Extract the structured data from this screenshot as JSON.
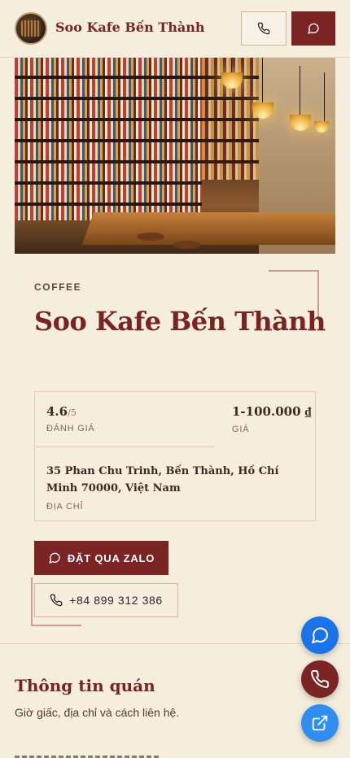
{
  "header": {
    "brand": "Soo Kafe Bến Thành",
    "call_icon": "phone-icon",
    "chat_icon": "chat-bubble-icon",
    "accent_color": "#7b2423"
  },
  "hero": {
    "alt_icon": "cafe-interior-photo"
  },
  "place": {
    "category": "COFFEE",
    "name": "Soo Kafe Bến Thành",
    "rating": "4.6",
    "rating_suffix": "/5",
    "rating_label": "ĐÁNH GIÁ",
    "price": "1-100.000 ₫",
    "price_label": "GIÁ",
    "address": "35 Phan Chu Trinh, Bến Thành, Hồ Chí Minh 70000, Việt Nam",
    "address_label": "ĐỊA CHỈ"
  },
  "actions": {
    "zalo_label": "ĐẶT QUA ZALO",
    "phone_label": "+84 899 312 386"
  },
  "section": {
    "title": "Thông tin quán",
    "subtitle": "Giờ giấc, địa chỉ và cách liên hệ."
  },
  "fabs": [
    {
      "icon": "chat-bubble-icon",
      "color": "#1a73e8"
    },
    {
      "icon": "phone-icon",
      "color": "#7b2423"
    },
    {
      "icon": "external-link-icon",
      "color": "#2f8ef0"
    }
  ]
}
